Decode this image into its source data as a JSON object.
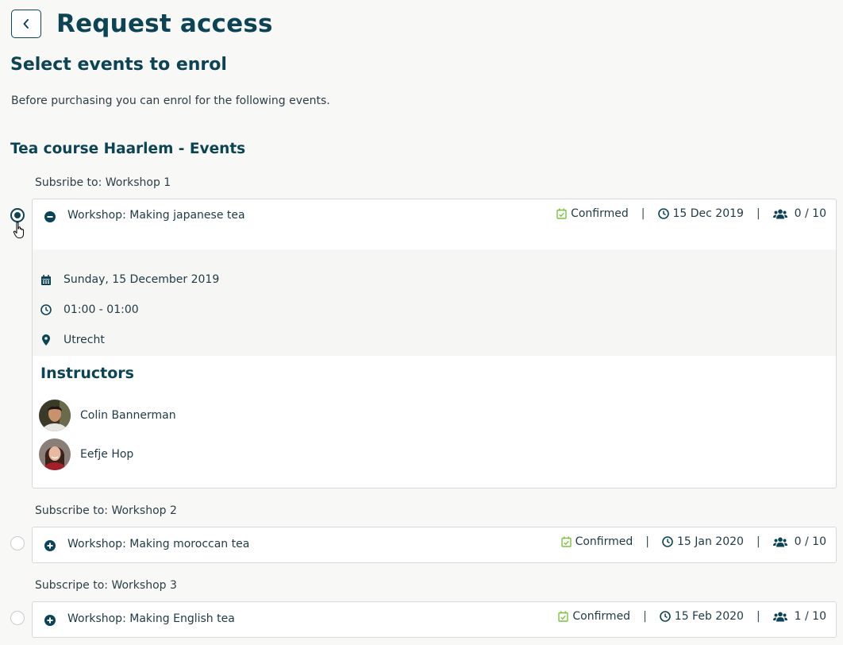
{
  "page": {
    "title": "Request access",
    "subtitle": "Select events to enrol",
    "intro": "Before purchasing you can enrol for the following events.",
    "course_title": "Tea course Haarlem - Events"
  },
  "events": [
    {
      "group_label": "Subsribe to: Workshop 1",
      "title": "Workshop: Making japanese tea",
      "status": "Confirmed",
      "date_short": "15 Dec 2019",
      "capacity": "0 / 10",
      "selected": true,
      "expanded": true,
      "details": {
        "date_long": "Sunday, 15 December 2019",
        "time": "01:00 - 01:00",
        "location": "Utrecht"
      },
      "instructors_heading": "Instructors",
      "instructors": [
        {
          "name": "Colin Bannerman"
        },
        {
          "name": "Eefje Hop"
        }
      ]
    },
    {
      "group_label": "Subscribe to: Workshop 2",
      "title": "Workshop: Making moroccan tea",
      "status": "Confirmed",
      "date_short": "15 Jan 2020",
      "capacity": "0 / 10",
      "selected": false,
      "expanded": false
    },
    {
      "group_label": "Subscripe to: Workshop 3",
      "title": "Workshop: Making English tea",
      "status": "Confirmed",
      "date_short": "15 Feb 2020",
      "capacity": "1 / 10",
      "selected": false,
      "expanded": false
    }
  ],
  "icons": {
    "back": "chevron-left-icon",
    "collapse": "minus-circle-icon",
    "expand": "plus-circle-icon",
    "status": "calendar-check-icon",
    "date": "clock-icon",
    "capacity": "users-icon",
    "calendar": "calendar-icon",
    "time": "clock-icon",
    "location": "map-pin-icon"
  },
  "colors": {
    "primary": "#0c4456",
    "confirmed": "#7cc243",
    "border": "#d6d9db"
  },
  "separator": "|"
}
